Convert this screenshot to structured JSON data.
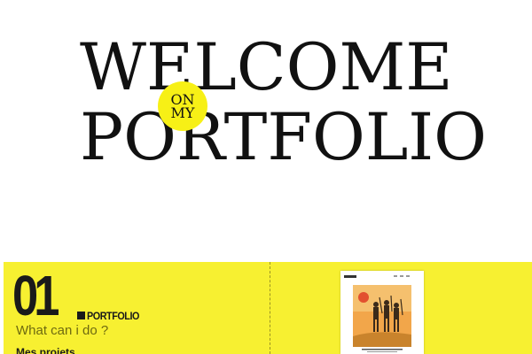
{
  "hero": {
    "line1": "WELCOME",
    "line2": "PORTFOLIO",
    "badge_line1": "ON",
    "badge_line2": "MY"
  },
  "section": {
    "number": "01",
    "label": "PORTFOLIO",
    "subtitle": "What can i do ?",
    "heading": "Mes projets"
  },
  "thumbnail": {
    "icon": "project-poster-thumbnail"
  },
  "colors": {
    "accent": "#f7f016",
    "section_bg": "#f7f031",
    "text": "#111111"
  }
}
